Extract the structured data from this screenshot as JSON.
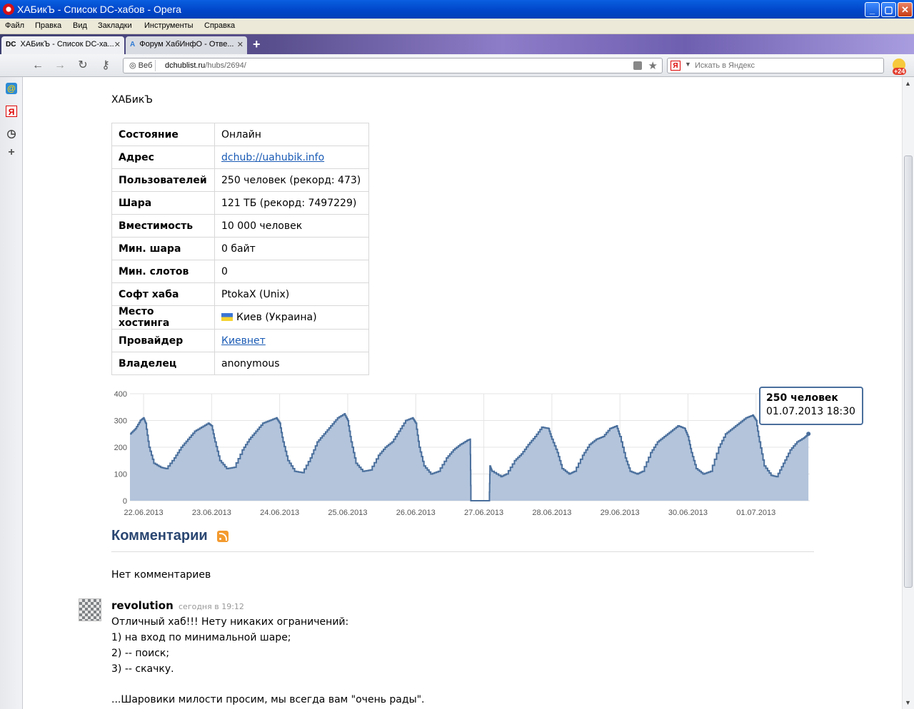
{
  "window": {
    "title": "ХАБикЪ - Список DC-хабов - Opera",
    "colors": {
      "titlebar": "#0044c8",
      "link": "#1a5bb5",
      "heading": "#2a4671",
      "chart_fill": "#b3c4db",
      "chart_line": "#4a6f9c"
    }
  },
  "menu": [
    "Файл",
    "Правка",
    "Вид",
    "Закладки",
    "Инструменты",
    "Справка"
  ],
  "tabs": [
    {
      "favicon": "DC",
      "label": "ХАБикЪ - Список DC-ха...",
      "active": true
    },
    {
      "favicon": "A",
      "label": "Форум ХабИнфО - Отве...",
      "active": false
    }
  ],
  "toolbar": {
    "web_label": "Веб",
    "url_host": "dchublist.ru",
    "url_path": "/hubs/2694/",
    "search_engine": "Я",
    "search_placeholder": "Искать в Яндекс",
    "weather_temp": "+24"
  },
  "page": {
    "hub_name": "ХАБикЪ",
    "info": [
      {
        "key": "Состояние",
        "value": "Онлайн"
      },
      {
        "key": "Адрес",
        "value": "dchub://uahubik.info",
        "link": true
      },
      {
        "key": "Пользователей",
        "value": "250 человек (рекорд: 473)"
      },
      {
        "key": "Шара",
        "value": "121 ТБ (рекорд: 7497229)"
      },
      {
        "key": "Вместимость",
        "value": "10 000 человек"
      },
      {
        "key": "Мин. шара",
        "value": "0 байт"
      },
      {
        "key": "Мин. слотов",
        "value": "0"
      },
      {
        "key": "Софт хаба",
        "value": "PtokaX (Unix)"
      },
      {
        "key": "Место хостинга",
        "value": "Киев (Украина)",
        "flag": true
      },
      {
        "key": "Провайдер",
        "value": "Киевнет",
        "link": true
      },
      {
        "key": "Владелец",
        "value": "anonymous"
      }
    ],
    "tooltip": {
      "title": "250 человек",
      "subtitle": "01.07.2013 18:30"
    },
    "comments_heading": "Комментарии",
    "no_comments": "Нет комментариев",
    "comment": {
      "author": "revolution",
      "time": "сегодня в 19:12",
      "lines": [
        "Отличный хаб!!! Нету никаких ограничений:",
        "1) на вход по минимальной шаре;",
        "2) -- поиск;",
        "3) -- скачку.",
        "",
        "...Шаровики милости просим, мы всегда вам \"очень рады\"."
      ]
    }
  },
  "chart_data": {
    "type": "area",
    "ylim": [
      0,
      400
    ],
    "yticks": [
      0,
      100,
      200,
      300,
      400
    ],
    "categories": [
      "22.06.2013",
      "23.06.2013",
      "24.06.2013",
      "25.06.2013",
      "26.06.2013",
      "27.06.2013",
      "28.06.2013",
      "29.06.2013",
      "30.06.2013",
      "01.07.2013"
    ],
    "x_start": 21.8,
    "x_end": 31.77,
    "series": [
      {
        "values": [
          [
            21.8,
            250
          ],
          [
            21.88,
            270
          ],
          [
            21.95,
            300
          ],
          [
            22.0,
            310
          ],
          [
            22.03,
            290
          ],
          [
            22.08,
            200
          ],
          [
            22.15,
            140
          ],
          [
            22.25,
            125
          ],
          [
            22.33,
            120
          ],
          [
            22.45,
            160
          ],
          [
            22.55,
            200
          ],
          [
            22.65,
            230
          ],
          [
            22.75,
            260
          ],
          [
            22.85,
            275
          ],
          [
            22.95,
            290
          ],
          [
            23.0,
            280
          ],
          [
            23.05,
            220
          ],
          [
            23.12,
            150
          ],
          [
            23.22,
            120
          ],
          [
            23.33,
            125
          ],
          [
            23.45,
            190
          ],
          [
            23.55,
            230
          ],
          [
            23.65,
            260
          ],
          [
            23.75,
            290
          ],
          [
            23.85,
            300
          ],
          [
            23.95,
            310
          ],
          [
            24.0,
            290
          ],
          [
            24.05,
            220
          ],
          [
            24.12,
            150
          ],
          [
            24.22,
            110
          ],
          [
            24.33,
            105
          ],
          [
            24.45,
            160
          ],
          [
            24.55,
            220
          ],
          [
            24.65,
            250
          ],
          [
            24.75,
            280
          ],
          [
            24.85,
            310
          ],
          [
            24.95,
            325
          ],
          [
            25.0,
            300
          ],
          [
            25.05,
            220
          ],
          [
            25.12,
            140
          ],
          [
            25.22,
            110
          ],
          [
            25.33,
            115
          ],
          [
            25.45,
            170
          ],
          [
            25.55,
            200
          ],
          [
            25.65,
            220
          ],
          [
            25.75,
            260
          ],
          [
            25.85,
            300
          ],
          [
            25.95,
            310
          ],
          [
            26.0,
            290
          ],
          [
            26.05,
            200
          ],
          [
            26.12,
            130
          ],
          [
            26.22,
            100
          ],
          [
            26.33,
            110
          ],
          [
            26.45,
            160
          ],
          [
            26.55,
            190
          ],
          [
            26.65,
            210
          ],
          [
            26.75,
            225
          ],
          [
            26.8,
            230
          ],
          [
            26.81,
            0
          ],
          [
            27.08,
            0
          ],
          [
            27.09,
            130
          ],
          [
            27.12,
            110
          ],
          [
            27.25,
            90
          ],
          [
            27.33,
            100
          ],
          [
            27.45,
            150
          ],
          [
            27.55,
            175
          ],
          [
            27.65,
            210
          ],
          [
            27.75,
            240
          ],
          [
            27.85,
            275
          ],
          [
            27.95,
            270
          ],
          [
            28.0,
            230
          ],
          [
            28.08,
            180
          ],
          [
            28.15,
            120
          ],
          [
            28.25,
            100
          ],
          [
            28.33,
            110
          ],
          [
            28.45,
            170
          ],
          [
            28.55,
            210
          ],
          [
            28.65,
            230
          ],
          [
            28.75,
            240
          ],
          [
            28.85,
            270
          ],
          [
            28.95,
            280
          ],
          [
            29.0,
            240
          ],
          [
            29.08,
            160
          ],
          [
            29.15,
            110
          ],
          [
            29.25,
            100
          ],
          [
            29.33,
            110
          ],
          [
            29.45,
            180
          ],
          [
            29.55,
            220
          ],
          [
            29.65,
            240
          ],
          [
            29.75,
            260
          ],
          [
            29.85,
            280
          ],
          [
            29.95,
            270
          ],
          [
            30.0,
            240
          ],
          [
            30.05,
            180
          ],
          [
            30.12,
            120
          ],
          [
            30.22,
            100
          ],
          [
            30.33,
            110
          ],
          [
            30.45,
            200
          ],
          [
            30.55,
            250
          ],
          [
            30.65,
            270
          ],
          [
            30.75,
            290
          ],
          [
            30.85,
            310
          ],
          [
            30.95,
            320
          ],
          [
            31.0,
            300
          ],
          [
            31.05,
            220
          ],
          [
            31.12,
            130
          ],
          [
            31.22,
            95
          ],
          [
            31.3,
            90
          ],
          [
            31.4,
            140
          ],
          [
            31.5,
            190
          ],
          [
            31.6,
            220
          ],
          [
            31.7,
            235
          ],
          [
            31.77,
            250
          ]
        ]
      }
    ],
    "highlight": {
      "x": 31.77,
      "y": 250
    }
  }
}
